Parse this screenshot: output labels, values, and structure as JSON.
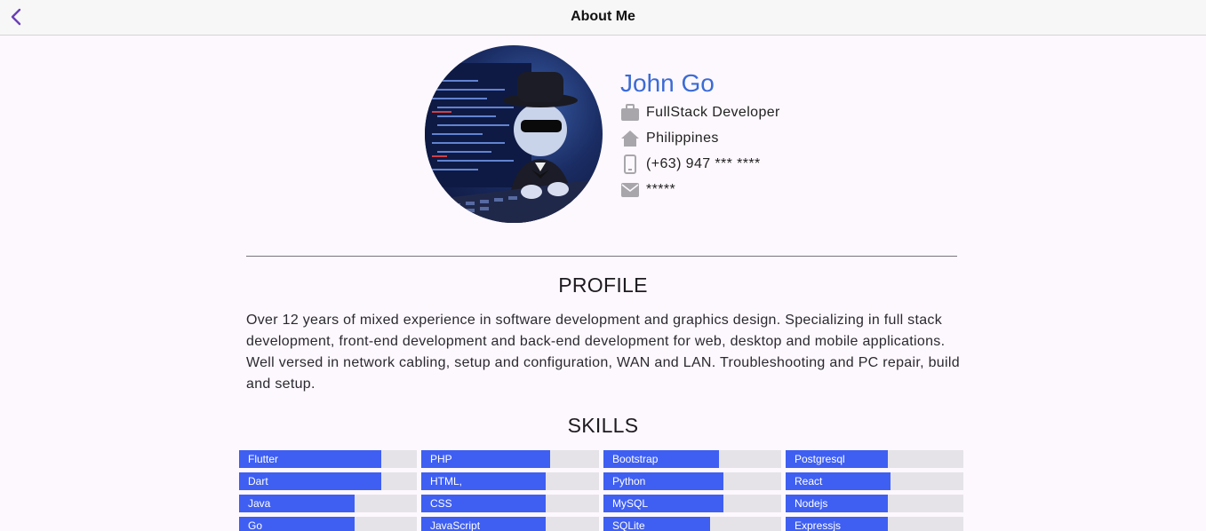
{
  "appbar": {
    "title": "About Me"
  },
  "icons": {
    "back": "back-arrow-icon",
    "job": "briefcase-icon",
    "location": "home-icon",
    "phone": "phone-icon",
    "email": "mail-icon"
  },
  "colors": {
    "accent": "#3b6bd6",
    "skill_fill": "#3f5ff2",
    "skill_track": "#e5e3e8",
    "back_icon": "#6a3fb6"
  },
  "profile": {
    "name": "John Go",
    "job": "FullStack Developer",
    "location": "Philippines",
    "phone": "(+63) 947 *** ****",
    "email": "*****"
  },
  "sections": {
    "profile_title": "PROFILE",
    "profile_text": "Over 12 years of mixed experience in software development and graphics design. Specializing in full stack development, front-end development and back-end development for web, desktop and mobile applications. Well versed in network cabling, setup and configuration, WAN and LAN. Troubleshooting and PC repair, build and setup.",
    "skills_title": "SKILLS"
  },
  "skills": [
    {
      "label": "Flutter",
      "level": 0.8
    },
    {
      "label": "PHP",
      "level": 0.725
    },
    {
      "label": "Bootstrap",
      "level": 0.65
    },
    {
      "label": "Postgresql",
      "level": 0.575
    },
    {
      "label": "Dart",
      "level": 0.8
    },
    {
      "label": "HTML,",
      "level": 0.7
    },
    {
      "label": "Python",
      "level": 0.675
    },
    {
      "label": "React",
      "level": 0.59
    },
    {
      "label": "Java",
      "level": 0.65
    },
    {
      "label": "CSS",
      "level": 0.7
    },
    {
      "label": "MySQL",
      "level": 0.675
    },
    {
      "label": "Nodejs",
      "level": 0.575
    },
    {
      "label": "Go",
      "level": 0.65
    },
    {
      "label": "JavaScript",
      "level": 0.7
    },
    {
      "label": "SQLite",
      "level": 0.6
    },
    {
      "label": "Expressjs",
      "level": 0.575
    }
  ]
}
